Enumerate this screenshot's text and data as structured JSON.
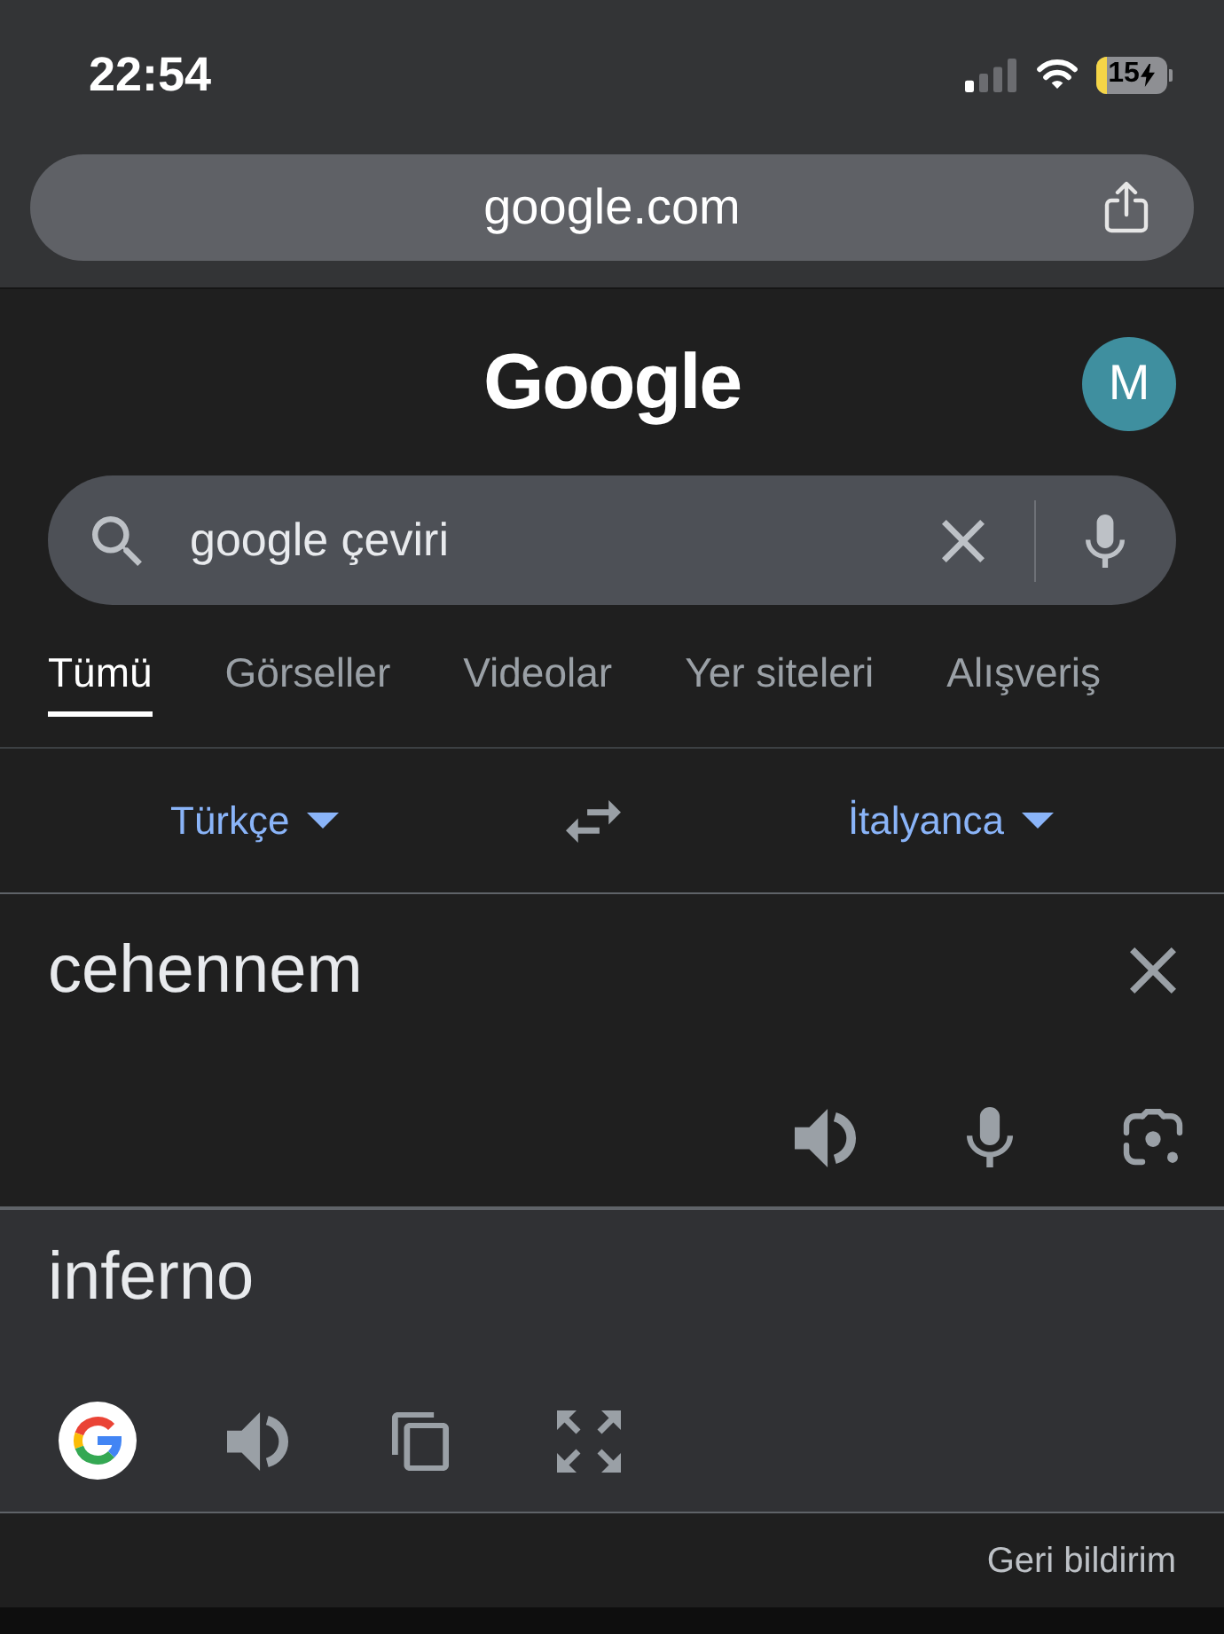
{
  "status_bar": {
    "time": "22:54",
    "battery": "15"
  },
  "address_bar": {
    "url": "google.com"
  },
  "header": {
    "logo": "Google",
    "avatar": "M"
  },
  "search": {
    "value": "google çeviri"
  },
  "tabs": [
    {
      "label": "Tümü",
      "selected": true
    },
    {
      "label": "Görseller",
      "selected": false
    },
    {
      "label": "Videolar",
      "selected": false
    },
    {
      "label": "Yer siteleri",
      "selected": false
    },
    {
      "label": "Alışveriş",
      "selected": false
    }
  ],
  "translator": {
    "source_language": "Türkçe",
    "target_language": "İtalyanca",
    "source_text": "cehennem",
    "translation": "inferno"
  },
  "footer": {
    "feedback": "Geri bildirim"
  }
}
